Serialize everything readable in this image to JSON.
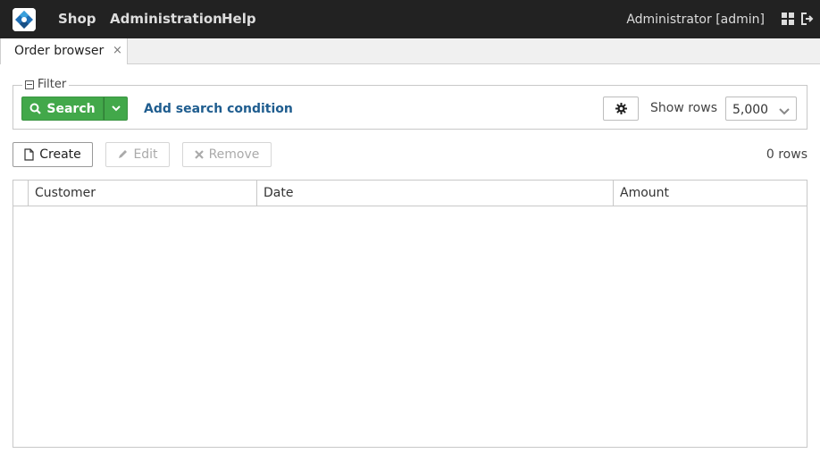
{
  "menu": {
    "items": [
      {
        "label": "Shop"
      },
      {
        "label": "Administration"
      },
      {
        "label": "Help"
      }
    ],
    "user": "Administrator [admin]"
  },
  "tabs": [
    {
      "label": "Order browser",
      "close": "×"
    }
  ],
  "filter": {
    "legend": "Filter",
    "search_label": "Search",
    "add_condition_label": "Add search condition",
    "show_rows_label": "Show rows",
    "show_rows_value": "5,000"
  },
  "toolbar": {
    "create_label": "Create",
    "edit_label": "Edit",
    "remove_label": "Remove",
    "rows_count": "0 rows"
  },
  "table": {
    "columns": [
      "Customer",
      "Date",
      "Amount"
    ],
    "rows": []
  },
  "colors": {
    "topbar": "#222222",
    "search_button": "#42a84a",
    "link": "#1f5d8f"
  },
  "icons": [
    "app-logo-icon",
    "grid-icon",
    "logout-icon",
    "filter-collapse-icon",
    "search-icon",
    "chevron-down-icon",
    "gear-icon",
    "file-icon",
    "pencil-icon",
    "close-icon"
  ]
}
